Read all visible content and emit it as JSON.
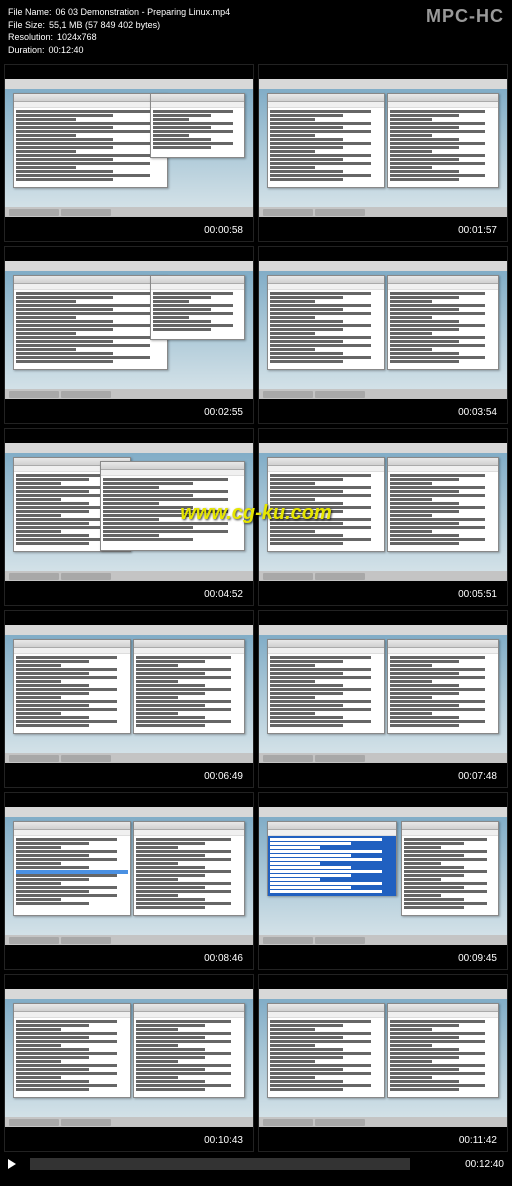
{
  "header": {
    "app_name": "MPC-HC",
    "meta": {
      "filename_label": "File Name:",
      "filename_value": "06 03 Demonstration - Preparing Linux.mp4",
      "filesize_label": "File Size:",
      "filesize_value": "55,1 MB (57 849 402 bytes)",
      "resolution_label": "Resolution:",
      "resolution_value": "1024x768",
      "duration_label": "Duration:",
      "duration_value": "00:12:40"
    }
  },
  "watermark": "www.cg-ku.com",
  "thumbnails": [
    {
      "timestamp": "00:00:58",
      "layout": "two-win-left"
    },
    {
      "timestamp": "00:01:57",
      "layout": "two-win-side"
    },
    {
      "timestamp": "00:02:55",
      "layout": "two-win-left"
    },
    {
      "timestamp": "00:03:54",
      "layout": "two-win-side"
    },
    {
      "timestamp": "00:04:52",
      "layout": "two-win-overlap"
    },
    {
      "timestamp": "00:05:51",
      "layout": "two-win-side"
    },
    {
      "timestamp": "00:06:49",
      "layout": "two-win-side"
    },
    {
      "timestamp": "00:07:48",
      "layout": "two-win-side"
    },
    {
      "timestamp": "00:08:46",
      "layout": "two-win-highlight"
    },
    {
      "timestamp": "00:09:45",
      "layout": "blue-win"
    },
    {
      "timestamp": "00:10:43",
      "layout": "two-win-side"
    },
    {
      "timestamp": "00:11:42",
      "layout": "two-win-side"
    }
  ],
  "footer": {
    "total_time": "00:12:40"
  }
}
